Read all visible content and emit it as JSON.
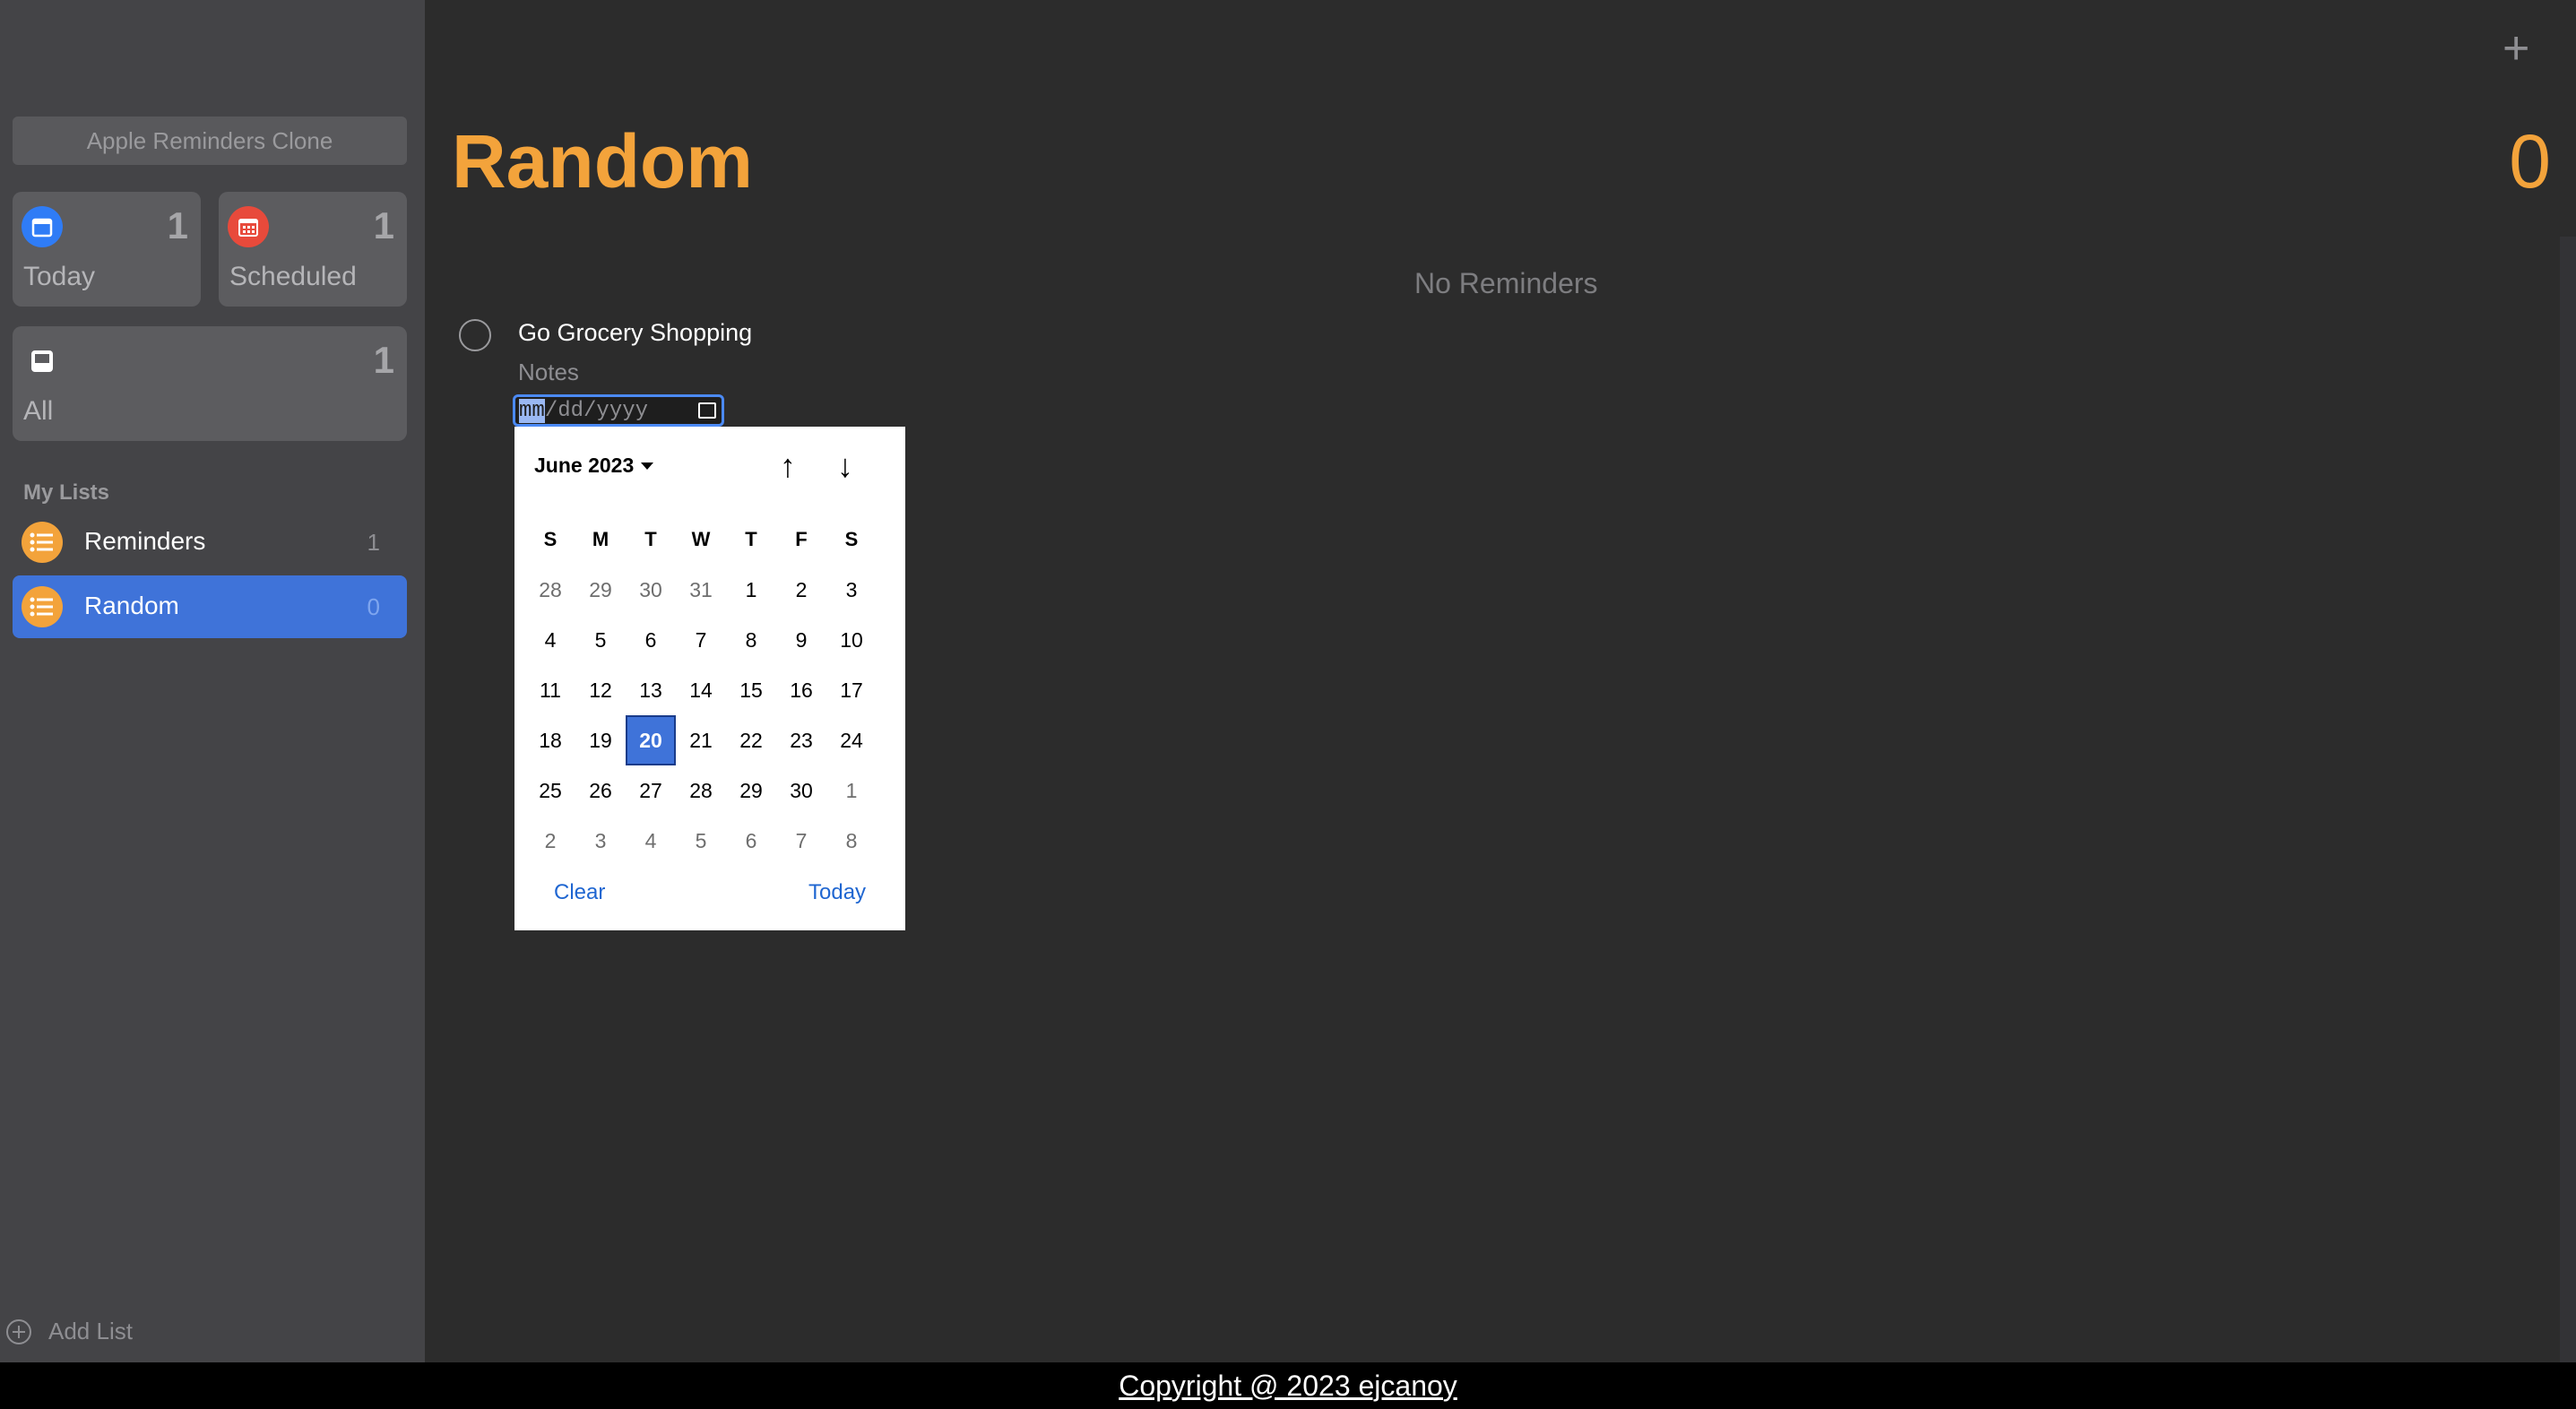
{
  "sidebar": {
    "search_placeholder": "Apple Reminders Clone",
    "smart_lists": [
      {
        "label": "Today",
        "count": "1",
        "icon": "calendar-icon",
        "color": "#2f7cf6"
      },
      {
        "label": "Scheduled",
        "count": "1",
        "icon": "calendar-grid-icon",
        "color": "#e84a3b"
      },
      {
        "label": "All",
        "count": "1",
        "icon": "tray-icon",
        "color": "#5c5c5f"
      }
    ],
    "my_lists_title": "My Lists",
    "lists": [
      {
        "name": "Reminders",
        "count": "1"
      },
      {
        "name": "Random",
        "count": "0"
      }
    ],
    "add_list_label": "Add List"
  },
  "main": {
    "plus_label": "+",
    "title": "Random",
    "count": "0",
    "empty_label": "No Reminders",
    "reminder": {
      "title": "Go Grocery Shopping",
      "notes_placeholder": "Notes",
      "date_mm": "mm",
      "date_rest": "/dd/yyyy"
    }
  },
  "calendar": {
    "month_label": "June 2023",
    "weekdays": [
      "S",
      "M",
      "T",
      "W",
      "T",
      "F",
      "S"
    ],
    "weeks": [
      [
        "28",
        "29",
        "30",
        "31",
        "1",
        "2",
        "3"
      ],
      [
        "4",
        "5",
        "6",
        "7",
        "8",
        "9",
        "10"
      ],
      [
        "11",
        "12",
        "13",
        "14",
        "15",
        "16",
        "17"
      ],
      [
        "18",
        "19",
        "20",
        "21",
        "22",
        "23",
        "24"
      ],
      [
        "25",
        "26",
        "27",
        "28",
        "29",
        "30",
        "1"
      ],
      [
        "2",
        "3",
        "4",
        "5",
        "6",
        "7",
        "8"
      ]
    ],
    "selected": "20",
    "clear_label": "Clear",
    "today_label": "Today",
    "up_arrow": "↑",
    "down_arrow": "↓"
  },
  "footer": {
    "copyright": "Copyright @ 2023 ejcanoy"
  },
  "colors": {
    "accent": "#f3a33b",
    "selection": "#3f73d9"
  }
}
